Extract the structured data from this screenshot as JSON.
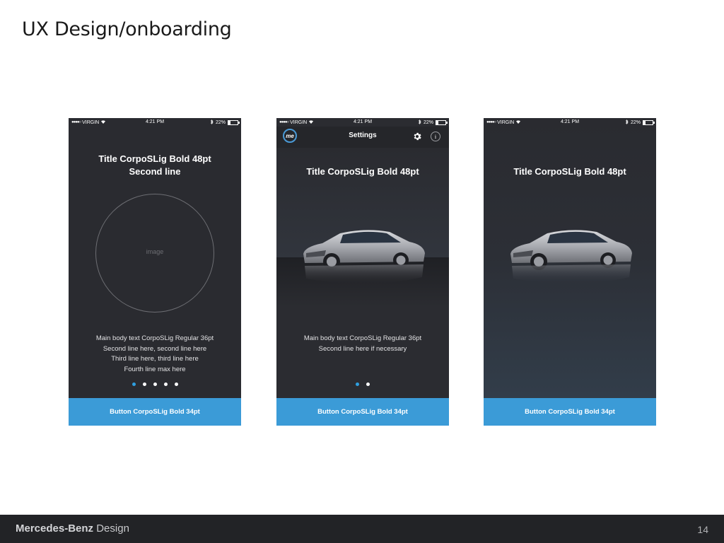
{
  "slide": {
    "title": "UX Design/onboarding"
  },
  "status_bar": {
    "carrier": "VIRGIN",
    "time": "4:21 PM",
    "battery": "22%"
  },
  "screens": [
    {
      "title_line1": "Title CorpoSLig Bold 48pt",
      "title_line2": "Second line",
      "image_label": "image",
      "body_lines": [
        "Main body text CorpoSLig Regular 36pt",
        "Second line here, second line here",
        "Third line here, third line here",
        "Fourth line max here"
      ],
      "page_count": 5,
      "active_page": 1,
      "button": "Button CorpoSLig Bold 34pt"
    },
    {
      "nav_title": "Settings",
      "logo_text": "me",
      "info_glyph": "i",
      "title": "Title CorpoSLig Bold 48pt",
      "body_lines": [
        "Main body text CorpoSLig Regular 36pt",
        "Second line here if necessary"
      ],
      "page_count": 2,
      "active_page": 1,
      "button": "Button CorpoSLig Bold 34pt"
    },
    {
      "title": "Title CorpoSLig Bold 48pt",
      "button": "Button CorpoSLig Bold 34pt"
    }
  ],
  "colors": {
    "accent": "#3b9bd7",
    "dot_active": "#2f9fe0",
    "screen_bg": "#2a2b30",
    "footer_bg": "#222326"
  },
  "footer": {
    "brand_bold": "Mercedes-Benz",
    "brand_light": "Design",
    "page_number": "14"
  }
}
